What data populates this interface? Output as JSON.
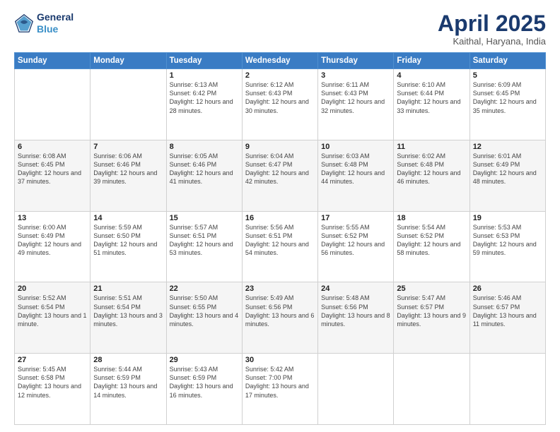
{
  "header": {
    "logo_line1": "General",
    "logo_line2": "Blue",
    "month": "April 2025",
    "location": "Kaithal, Haryana, India"
  },
  "weekdays": [
    "Sunday",
    "Monday",
    "Tuesday",
    "Wednesday",
    "Thursday",
    "Friday",
    "Saturday"
  ],
  "weeks": [
    [
      {
        "day": "",
        "sunrise": "",
        "sunset": "",
        "daylight": ""
      },
      {
        "day": "",
        "sunrise": "",
        "sunset": "",
        "daylight": ""
      },
      {
        "day": "1",
        "sunrise": "Sunrise: 6:13 AM",
        "sunset": "Sunset: 6:42 PM",
        "daylight": "Daylight: 12 hours and 28 minutes."
      },
      {
        "day": "2",
        "sunrise": "Sunrise: 6:12 AM",
        "sunset": "Sunset: 6:43 PM",
        "daylight": "Daylight: 12 hours and 30 minutes."
      },
      {
        "day": "3",
        "sunrise": "Sunrise: 6:11 AM",
        "sunset": "Sunset: 6:43 PM",
        "daylight": "Daylight: 12 hours and 32 minutes."
      },
      {
        "day": "4",
        "sunrise": "Sunrise: 6:10 AM",
        "sunset": "Sunset: 6:44 PM",
        "daylight": "Daylight: 12 hours and 33 minutes."
      },
      {
        "day": "5",
        "sunrise": "Sunrise: 6:09 AM",
        "sunset": "Sunset: 6:45 PM",
        "daylight": "Daylight: 12 hours and 35 minutes."
      }
    ],
    [
      {
        "day": "6",
        "sunrise": "Sunrise: 6:08 AM",
        "sunset": "Sunset: 6:45 PM",
        "daylight": "Daylight: 12 hours and 37 minutes."
      },
      {
        "day": "7",
        "sunrise": "Sunrise: 6:06 AM",
        "sunset": "Sunset: 6:46 PM",
        "daylight": "Daylight: 12 hours and 39 minutes."
      },
      {
        "day": "8",
        "sunrise": "Sunrise: 6:05 AM",
        "sunset": "Sunset: 6:46 PM",
        "daylight": "Daylight: 12 hours and 41 minutes."
      },
      {
        "day": "9",
        "sunrise": "Sunrise: 6:04 AM",
        "sunset": "Sunset: 6:47 PM",
        "daylight": "Daylight: 12 hours and 42 minutes."
      },
      {
        "day": "10",
        "sunrise": "Sunrise: 6:03 AM",
        "sunset": "Sunset: 6:48 PM",
        "daylight": "Daylight: 12 hours and 44 minutes."
      },
      {
        "day": "11",
        "sunrise": "Sunrise: 6:02 AM",
        "sunset": "Sunset: 6:48 PM",
        "daylight": "Daylight: 12 hours and 46 minutes."
      },
      {
        "day": "12",
        "sunrise": "Sunrise: 6:01 AM",
        "sunset": "Sunset: 6:49 PM",
        "daylight": "Daylight: 12 hours and 48 minutes."
      }
    ],
    [
      {
        "day": "13",
        "sunrise": "Sunrise: 6:00 AM",
        "sunset": "Sunset: 6:49 PM",
        "daylight": "Daylight: 12 hours and 49 minutes."
      },
      {
        "day": "14",
        "sunrise": "Sunrise: 5:59 AM",
        "sunset": "Sunset: 6:50 PM",
        "daylight": "Daylight: 12 hours and 51 minutes."
      },
      {
        "day": "15",
        "sunrise": "Sunrise: 5:57 AM",
        "sunset": "Sunset: 6:51 PM",
        "daylight": "Daylight: 12 hours and 53 minutes."
      },
      {
        "day": "16",
        "sunrise": "Sunrise: 5:56 AM",
        "sunset": "Sunset: 6:51 PM",
        "daylight": "Daylight: 12 hours and 54 minutes."
      },
      {
        "day": "17",
        "sunrise": "Sunrise: 5:55 AM",
        "sunset": "Sunset: 6:52 PM",
        "daylight": "Daylight: 12 hours and 56 minutes."
      },
      {
        "day": "18",
        "sunrise": "Sunrise: 5:54 AM",
        "sunset": "Sunset: 6:52 PM",
        "daylight": "Daylight: 12 hours and 58 minutes."
      },
      {
        "day": "19",
        "sunrise": "Sunrise: 5:53 AM",
        "sunset": "Sunset: 6:53 PM",
        "daylight": "Daylight: 12 hours and 59 minutes."
      }
    ],
    [
      {
        "day": "20",
        "sunrise": "Sunrise: 5:52 AM",
        "sunset": "Sunset: 6:54 PM",
        "daylight": "Daylight: 13 hours and 1 minute."
      },
      {
        "day": "21",
        "sunrise": "Sunrise: 5:51 AM",
        "sunset": "Sunset: 6:54 PM",
        "daylight": "Daylight: 13 hours and 3 minutes."
      },
      {
        "day": "22",
        "sunrise": "Sunrise: 5:50 AM",
        "sunset": "Sunset: 6:55 PM",
        "daylight": "Daylight: 13 hours and 4 minutes."
      },
      {
        "day": "23",
        "sunrise": "Sunrise: 5:49 AM",
        "sunset": "Sunset: 6:56 PM",
        "daylight": "Daylight: 13 hours and 6 minutes."
      },
      {
        "day": "24",
        "sunrise": "Sunrise: 5:48 AM",
        "sunset": "Sunset: 6:56 PM",
        "daylight": "Daylight: 13 hours and 8 minutes."
      },
      {
        "day": "25",
        "sunrise": "Sunrise: 5:47 AM",
        "sunset": "Sunset: 6:57 PM",
        "daylight": "Daylight: 13 hours and 9 minutes."
      },
      {
        "day": "26",
        "sunrise": "Sunrise: 5:46 AM",
        "sunset": "Sunset: 6:57 PM",
        "daylight": "Daylight: 13 hours and 11 minutes."
      }
    ],
    [
      {
        "day": "27",
        "sunrise": "Sunrise: 5:45 AM",
        "sunset": "Sunset: 6:58 PM",
        "daylight": "Daylight: 13 hours and 12 minutes."
      },
      {
        "day": "28",
        "sunrise": "Sunrise: 5:44 AM",
        "sunset": "Sunset: 6:59 PM",
        "daylight": "Daylight: 13 hours and 14 minutes."
      },
      {
        "day": "29",
        "sunrise": "Sunrise: 5:43 AM",
        "sunset": "Sunset: 6:59 PM",
        "daylight": "Daylight: 13 hours and 16 minutes."
      },
      {
        "day": "30",
        "sunrise": "Sunrise: 5:42 AM",
        "sunset": "Sunset: 7:00 PM",
        "daylight": "Daylight: 13 hours and 17 minutes."
      },
      {
        "day": "",
        "sunrise": "",
        "sunset": "",
        "daylight": ""
      },
      {
        "day": "",
        "sunrise": "",
        "sunset": "",
        "daylight": ""
      },
      {
        "day": "",
        "sunrise": "",
        "sunset": "",
        "daylight": ""
      }
    ]
  ]
}
